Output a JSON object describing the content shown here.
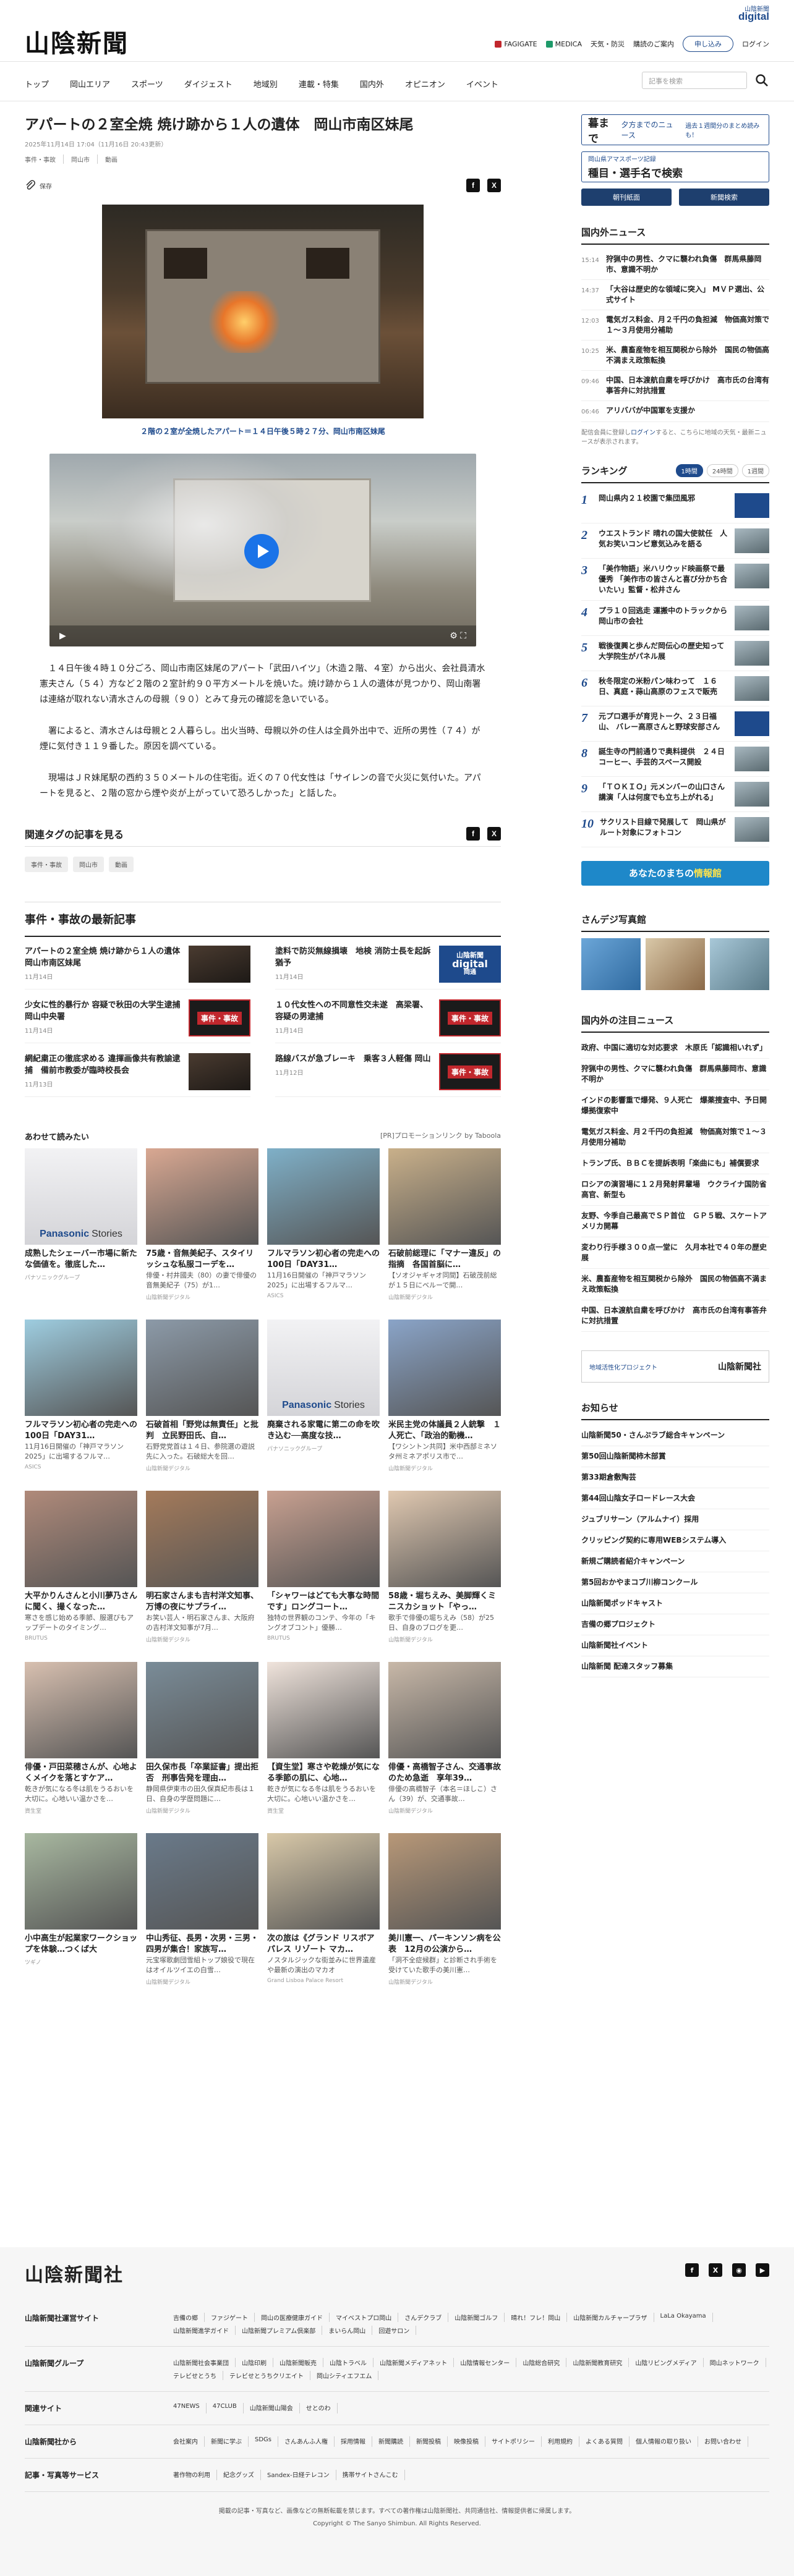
{
  "header": {
    "logo": "山陰新聞",
    "digital_top": "山陰新聞",
    "digital": "digital",
    "links": [
      "FAGIGATE",
      "MEDICA",
      "天気・防災",
      "購読のご案内"
    ],
    "signup": "申し込み",
    "login": "ログイン"
  },
  "nav": {
    "items": [
      "トップ",
      "岡山エリア",
      "スポーツ",
      "ダイジェスト",
      "地域別",
      "連載・特集",
      "国内外",
      "オピニオン",
      "イベント"
    ],
    "search_placeholder": "記事を検索"
  },
  "article": {
    "title": "アパートの２室全焼 焼け跡から１人の遺体　岡山市南区妹尾",
    "date": "2025年11月14日 17:04（11月16日 20:43更新）",
    "tags_line": [
      "事件・事故",
      "岡山市",
      "動画"
    ],
    "save_label": "保存",
    "photo_caption": "２階の２室が全焼したアパート＝１４日午後５時２７分、岡山市南区妹尾",
    "paragraphs": [
      "１４日午後４時１０分ごろ、岡山市南区妹尾のアパート「武田ハイツ」（木造２階、４室）から出火、会社員清水憲夫さん（５４）方など２階の２室計約９０平方メートルを焼いた。焼け跡から１人の遺体が見つかり、岡山南署は連絡が取れない清水さんの母親（９０）とみて身元の確認を急いでいる。",
      "署によると、清水さんは母親と２人暮らし。出火当時、母親以外の住人は全員外出中で、近所の男性（７４）が煙に気付き１１９番した。原因を調べている。",
      "現場はＪＲ妹尾駅の西約３５０メートルの住宅街。近くの７０代女性は「サイレンの音で火災に気付いた。アパートを見ると、２階の窓から煙や炎が上がっていて恐ろしかった」と話した。"
    ],
    "related_title": "関連タグの記事を見る",
    "related_tags": [
      "事件・事故",
      "岡山市",
      "動画"
    ]
  },
  "latest": {
    "title": "事件・事故の最新記事",
    "items": [
      {
        "title": "アパートの２室全焼 焼け跡から１人の遺体　岡山市南区妹尾",
        "date": "11月14日",
        "thumb": "photo"
      },
      {
        "title": "塗料で防災無線損壊　地検 消防士長を起訴猶予",
        "date": "11月14日",
        "thumb": "digital"
      },
      {
        "title": "少女に性的暴行か 容疑で秋田の大学生逮捕　岡山中央署",
        "date": "11月14日",
        "thumb": "jiken"
      },
      {
        "title": "１０代女性への不同意性交未遂　高梁署、容疑の男逮捕",
        "date": "11月14日",
        "thumb": "jiken"
      },
      {
        "title": "網紀粛正の徹底求める 違揮画像共有教諭逮捕　備前市教委が臨時校長会",
        "date": "11月13日",
        "thumb": "photo"
      },
      {
        "title": "路線バスが急ブレーキ　乗客３人軽傷 岡山",
        "date": "11月12日",
        "thumb": "jiken"
      }
    ],
    "digital_thumb_top": "山陰新聞",
    "digital_thumb_bottom": "digital",
    "digital_thumb_label": "岡通",
    "jiken_label": "事件・事故"
  },
  "recommend": {
    "title": "あわせて読みたい",
    "sponsor": "[PR]プロモーションリンク by Taboola",
    "panasonic": "Panasonic",
    "stories": "Stories",
    "items": [
      {
        "title": "成熟したシェーバー市場に新たな価値を。徹底した…",
        "desc": "",
        "src": "パナソニックグループ",
        "img": "panasonic"
      },
      {
        "title": "75歳・音無美紀子、スタイリッシュな私服コーデを…",
        "desc": "俳優・村井國夫（80）の妻で俳優の音無美紀子（75）が1…",
        "src": "山陰新聞デジタル",
        "img": "p2"
      },
      {
        "title": "フルマラソン初心者の完走への100日「DAY31…",
        "desc": "11月16日開催の「神戸マラソン2025」に出場するフルマ…",
        "src": "ASICS",
        "img": "p3"
      },
      {
        "title": "石破前総理に「マナー違反」の指摘　各国首脳に…",
        "desc": "【ソオジャギャオ同間】石破茂前総が１５日にベルーで開…",
        "src": "山陰新聞デジタル",
        "img": "p4"
      },
      {
        "title": "フルマラソン初心者の完走への100日「DAY31…",
        "desc": "11月16日開催の「神戸マラソン2025」に出場するフルマ…",
        "src": "ASICS",
        "img": "p5"
      },
      {
        "title": "石破首相「野党は無責任」と批判　立民野田氏、自…",
        "desc": "石野党党首は１４日、参院選の遊説先に入った。石破総大を回…",
        "src": "山陰新聞デジタル",
        "img": "p6"
      },
      {
        "title": "廃棄される家電に第二の命を吹き込む──高度な技…",
        "desc": "",
        "src": "パナソニックグループ",
        "img": "panasonic2"
      },
      {
        "title": "米民主党の体議員２人銃撃　１人死亡、「政治的動機…",
        "desc": "【ワシントン共同】米中西部ミネソタ州ミネアポリス市で…",
        "src": "山陰新聞デジタル",
        "img": "p8"
      },
      {
        "title": "大平かりんさんと小川夢乃さんに聞く、撮くなった…",
        "desc": "寒さを感じ始める季節、服選びもアップデートのタイミング…",
        "src": "BRUTUS",
        "img": "p9"
      },
      {
        "title": "明石家さんまも吉村洋文知事、万博の夜にサプライ…",
        "desc": "お笑い芸人・明石家さんま、大阪府の吉村洋文知事が7月…",
        "src": "山陰新聞デジタル",
        "img": "p10"
      },
      {
        "title": "「シャワーはどても大事な時間です」ロングコート…",
        "desc": "独特の世界観のコンテ、今年の「キングオブコント」優勝…",
        "src": "BRUTUS",
        "img": "p11"
      },
      {
        "title": "58歳・堀ちえみ、美脚輝くミニスカショット「やっ…",
        "desc": "歌手で俳優の堀ちえみ（58）が25日、自身のブログを更…",
        "src": "山陰新聞デジタル",
        "img": "p12"
      },
      {
        "title": "俳優・戸田菜穂さんが、心地よくメイクを落とすケア…",
        "desc": "乾きが気になる冬は肌をうるおいを大切に。心地いい温かさを…",
        "src": "資生堂",
        "img": "p13"
      },
      {
        "title": "田久保市長「卒業証書」提出拒否　刑事告発を理由…",
        "desc": "静岡県伊東市の田久保真紀市長は１日、自身の学歴問題に…",
        "src": "山陰新聞デジタル",
        "img": "p14"
      },
      {
        "title": "【資生堂】寒さや乾燥が気になる季節の肌に、心地…",
        "desc": "乾きが気になる冬は肌をうるおいを大切に。心地いい温かさを…",
        "src": "資生堂",
        "img": "p15"
      },
      {
        "title": "俳優・高橋智子さん、交通事故のため急逝　享年39…",
        "desc": "俳優の高橋智子（本名＝ほしこ）さん（39）が、交通事故…",
        "src": "山陰新聞デジタル",
        "img": "p16"
      },
      {
        "title": "小中高生が起業家ワークショップを体験…つくば大",
        "desc": "",
        "src": "ツギノ",
        "img": "p17"
      },
      {
        "title": "中山秀征、長男・次男・三男・四男が集合！家族写…",
        "desc": "元宝塚歌劇団雪組トップ娘役で現在はオイルツイエの白雪…",
        "src": "山陰新聞デジタル",
        "img": "p18"
      },
      {
        "title": "次の旅は《グランド リスボア パレス リゾート マカ…",
        "desc": "ノスタルジックな街並みに世界遺産や最新の演出のマカオ",
        "src": "Grand Lisboa Palace Resort",
        "img": "p19"
      },
      {
        "title": "美川憲一、パーキンソン病を公表　12月の公演から…",
        "desc": "「洞不全症候群」と診断され手術を受けていた歌手の美川憲…",
        "src": "山陰新聞デジタル",
        "img": "p20"
      }
    ]
  },
  "sidebar": {
    "banner1_a": "暮まで",
    "banner1_b": "夕方までのニュース",
    "banner1_c": "過去１週間分のまとめ読みも！",
    "banner2_a": "岡山県アマスポーツ記録",
    "banner2_b": "種目・選手名で検索",
    "btn1": "朝刊紙面",
    "btn2": "新聞検索",
    "news_title": "国内外ニュース",
    "news": [
      {
        "time": "15:14",
        "text": "狩猟中の男性、クマに襲われ負傷　群馬県藤岡市、意識不明か"
      },
      {
        "time": "14:37",
        "text": "「大谷は歴史的な領域に突入」 MＶＰ選出、公式サイト"
      },
      {
        "time": "12:03",
        "text": "電気ガス料金、月２千円の負担減　物価高対策で１～３月使用分補助"
      },
      {
        "time": "10:25",
        "text": "米、農畜産物を相互関税から除外　国民の物価高不満まえ政策転換"
      },
      {
        "time": "09:46",
        "text": "中国、日本渡航自粛を呼びかけ　高市氏の台湾有事答弁に対抗措置"
      },
      {
        "time": "06:46",
        "text": "アリババが中国軍を支援か"
      }
    ],
    "note_a": "配信会員に登録し",
    "note_link": "ログイン",
    "note_b": "すると、こちらに地域の天気・最新ニュースが表示されます。",
    "ranking_title": "ランキング",
    "ranking_tabs": [
      "1時間",
      "24時間",
      "1週間"
    ],
    "ranking": [
      {
        "n": "1",
        "text": "岡山県内２１校園で集団風邪",
        "thumb": "digital"
      },
      {
        "n": "2",
        "text": "ウエストランド 晴れの国大使就任　人気お笑いコンビ意気込みを語る",
        "thumb": "photo"
      },
      {
        "n": "3",
        "text": "「美作物語」米ハリウッド映画祭で最優秀 「美作市の皆さんと喜び分かち合いたい」監督・松井さん",
        "thumb": "photo"
      },
      {
        "n": "4",
        "text": "プラ１０回逃走 運搬中のトラックから　岡山市の会社",
        "thumb": "photo"
      },
      {
        "n": "5",
        "text": "戦後復興と歩んだ岡伝心の歴史知って　大学院生がパネル展",
        "thumb": "photo"
      },
      {
        "n": "6",
        "text": "秋冬限定の米粉パン味わって　１６日、真庭・蒜山高原のフェスで販売",
        "thumb": "photo"
      },
      {
        "n": "7",
        "text": "元プロ選手が育児トーク、２３日福山、 バレー高原さんと野球安部さん",
        "thumb": "digital"
      },
      {
        "n": "8",
        "text": "誕生寺の門前通りで奥料提供　２４日コーヒー、手芸的スペース開設",
        "thumb": "photo"
      },
      {
        "n": "9",
        "text": "「ＴＯＫＩＯ」元メンバーの山口さん講演「人は何度でも立ち上がれる」",
        "thumb": "photo"
      },
      {
        "n": "10",
        "text": "サクリスト目線で発展して　岡山県がルート対象にフォトコン",
        "thumb": "photo"
      }
    ],
    "town_a": "あなたのまちの",
    "town_b": "情報館",
    "photo_title": "さんデジ写真館",
    "notable_title": "国内外の注目ニュース",
    "notable": [
      "政府、中国に適切な対応要求　木原氏「認識相いれず」",
      "狩猟中の男性、クマに襲われ負傷　群馬県藤岡市、意識不明か",
      "インドの影響重で爆発、９人死亡　爆薬捜査中、予日開爆拠復索中",
      "電気ガス料金、月２千円の負担減　物価高対策で１～３月使用分補助",
      "トランプ氏、ＢＢＣを提訴表明「楽曲にも」補償要求",
      "ロシアの演習場に１２月発射昇輩場　ウクライナ国防省高官、新型も",
      "友野、今季自己最高でＳＰ首位　ＧＰ５戦、スケートアメリカ開幕",
      "変わり行手様３００点一堂に　久月本社で４０年の歴史展",
      "米、農畜産物を相互関税から除外　国民の物価高不満まえ政策転換",
      "中国、日本渡航自粛を呼びかけ　高市氏の台湾有事答弁に対抗措置"
    ],
    "bnr2_a": "地域活性化プロジェクト",
    "bnr2_b": "山陰新聞社",
    "notice_title": "お知らせ",
    "notices": [
      "山陰新聞50・さんぷラブ総合キャンペーン",
      "第50回山陰新聞柿木部賞",
      "第33期倉敷陶芸",
      "第44回山陰女子ロードレース大会",
      "ジュブリサーン（アルムナイ）採用",
      "クリッピング契約に専用WEBシステム導入",
      "新規ご購読者紹介キャンペーン",
      "第5回おかやまコブ川柳コンクール",
      "山陰新聞ポッドキャスト",
      "吉備の郷プロジェクト",
      "山陰新聞社イベント",
      "山陰新聞 配達スタッフ募集"
    ]
  },
  "footer": {
    "logo": "山陰新聞社",
    "rows": [
      {
        "label": "山陰新聞社運営サイト",
        "links": [
          "吉備の郷",
          "ファジゲート",
          "岡山の医療健康ガイド",
          "マイベストプロ岡山",
          "さんデクラブ",
          "山陰新聞ゴルフ",
          "晴れ！フレ！岡山",
          "山陰新聞カルチャープラザ",
          "LaLa Okayama",
          "山陰新聞進学ガイド",
          "山陰新聞プレミアム倶楽部",
          "まいらん岡山",
          "回遊サロン"
        ]
      },
      {
        "label": "山陰新聞グループ",
        "links": [
          "山陰新聞社会事業団",
          "山陰印刷",
          "山陰新聞販売",
          "山陰トラベル",
          "山陰新聞メディアネット",
          "山陰情報センター",
          "山陰総合研究",
          "山陰新聞教育研究",
          "山陰リビングメディア",
          "岡山ネットワーク",
          "テレビせとうち",
          "テレビせとうちクリエイト",
          "岡山シティエフエム"
        ]
      },
      {
        "label": "関連サイト",
        "links": [
          "47NEWS",
          "47CLUB",
          "山陰新聞山陽会",
          "せとのわ"
        ]
      },
      {
        "label": "山陰新聞社から",
        "links": [
          "会社案内",
          "新聞に学ぶ",
          "SDGs",
          "さんあんふ人権",
          "採用情報",
          "新聞購読",
          "新聞投稿",
          "映像投稿",
          "サイトポリシー",
          "利用規約",
          "よくある質問",
          "個人情報の取り扱い",
          "お問い合わせ"
        ]
      },
      {
        "label": "記事・写真等サービス",
        "links": [
          "著作物の利用",
          "紀念グッズ",
          "Sandex-日経テレコン",
          "携帯サイトさんこむ"
        ]
      }
    ],
    "copy_note": "掲載の記事・写真など、画像などの無断転載を禁じます。すべての著作権は山陰新聞社、共同通信社、情報提供者に帰属します。",
    "copyright": "Copyright © The Sanyo Shimbun. All Rights Reserved."
  }
}
